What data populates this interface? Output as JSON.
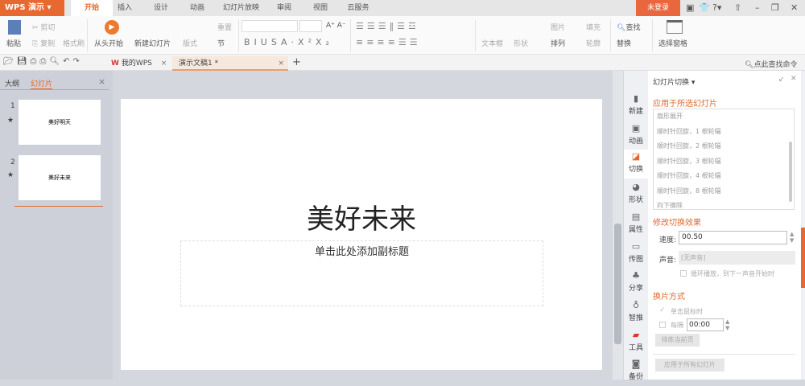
{
  "app": {
    "logo": "WPS 演示",
    "login": "未登录"
  },
  "menu_tabs": [
    "开始",
    "插入",
    "设计",
    "动画",
    "幻灯片放映",
    "审阅",
    "视图",
    "云服务"
  ],
  "ribbon": {
    "paste": "粘贴",
    "cut": "剪切",
    "copy": "复制",
    "format_painter": "格式刷",
    "play_from_start": "从头开始",
    "new_slide": "新建幻灯片",
    "layout": "版式",
    "reset": "重置",
    "section": "节",
    "textbox": "文本框",
    "shape": "形状",
    "picture": "图片",
    "fill": "填充",
    "arrange": "排列",
    "outline": "轮廓",
    "find": "查找",
    "replace": "替换",
    "select_pane": "选择窗格"
  },
  "doc_tabs": [
    {
      "label": "我的WPS"
    },
    {
      "label": "演示文稿1 *"
    }
  ],
  "search_cmd": "点此查找命令",
  "left_panel": {
    "tab_outline": "大纲",
    "tab_slides": "幻灯片",
    "slides": [
      {
        "num": "1",
        "title": "美好明天"
      },
      {
        "num": "2",
        "title": "美好未来"
      }
    ]
  },
  "slide": {
    "title": "美好未来",
    "subtitle_placeholder": "单击此处添加副标题"
  },
  "iconbar": [
    "新建",
    "动画",
    "切换",
    "形状",
    "属性",
    "传图",
    "分享",
    "智推",
    "工具",
    "备份"
  ],
  "pane": {
    "title": "幻灯片切换",
    "apply_selected": "应用于所选幻灯片",
    "transitions": [
      "扇形展开",
      "顺时针回旋，1 根轮辐",
      "顺时针回旋，2 根轮辐",
      "顺时针回旋，3 根轮辐",
      "顺时针回旋，4 根轮辐",
      "顺时针回旋，8 根轮辐",
      "向下擦除"
    ],
    "modify": "修改切换效果",
    "speed_label": "速度:",
    "speed": "00.50",
    "sound_label": "声音:",
    "sound": "[无声音]",
    "loop": "循环播放，到下一声音开始时",
    "advance": "换片方式",
    "on_click": "单击鼠标时",
    "every": "每隔",
    "every_value": "00:00",
    "rehearse": "排练当前页",
    "apply_all": "应用于所有幻灯片"
  },
  "colors": {
    "accent": "#e8692f"
  }
}
